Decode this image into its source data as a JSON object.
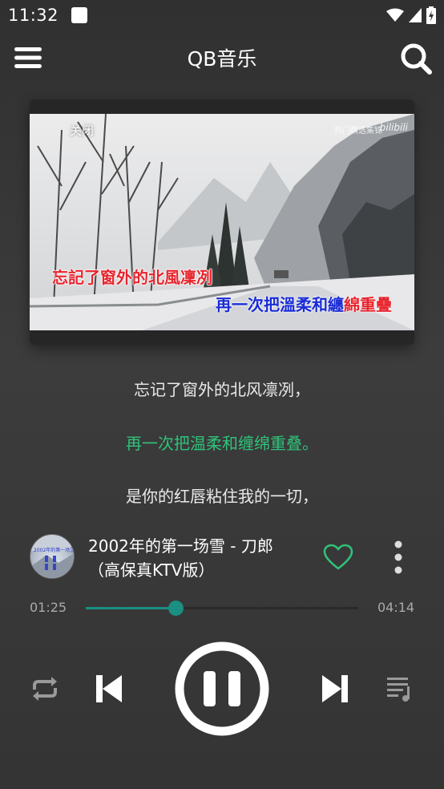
{
  "status_bar": {
    "time": "11:32"
  },
  "header": {
    "title": "QB音乐"
  },
  "video": {
    "close_label": "关闭",
    "watermark": "热门精选集锦",
    "logo": "bilibili",
    "subtitle_line1": "忘記了窗外的北風凜冽",
    "subtitle_line2_sung": "再一次把溫柔和纏",
    "subtitle_line2_rest": "綿重疊"
  },
  "lyrics": [
    {
      "text": "忘记了窗外的北风凛冽，",
      "active": false
    },
    {
      "text": "再一次把温柔和缠绵重叠。",
      "active": true
    },
    {
      "text": "是你的红唇粘住我的一切，",
      "active": false
    }
  ],
  "now_playing": {
    "title": "2002年的第一场雪 - 刀郎（高保真KTV版）",
    "album_art_text": "2002年的第一场雪"
  },
  "progress": {
    "current": "01:25",
    "total": "04:14",
    "fraction": 0.33
  },
  "colors": {
    "accent": "#1a8f82",
    "active_lyric": "#2fc27a",
    "heart": "#2fc27a"
  },
  "icons": {
    "menu": "hamburger-menu-icon",
    "search": "search-icon",
    "heart": "heart-outline-icon",
    "more": "more-vertical-icon",
    "repeat": "repeat-icon",
    "prev": "skip-previous-icon",
    "pause": "pause-icon",
    "next": "skip-next-icon",
    "playlist": "playlist-icon"
  }
}
